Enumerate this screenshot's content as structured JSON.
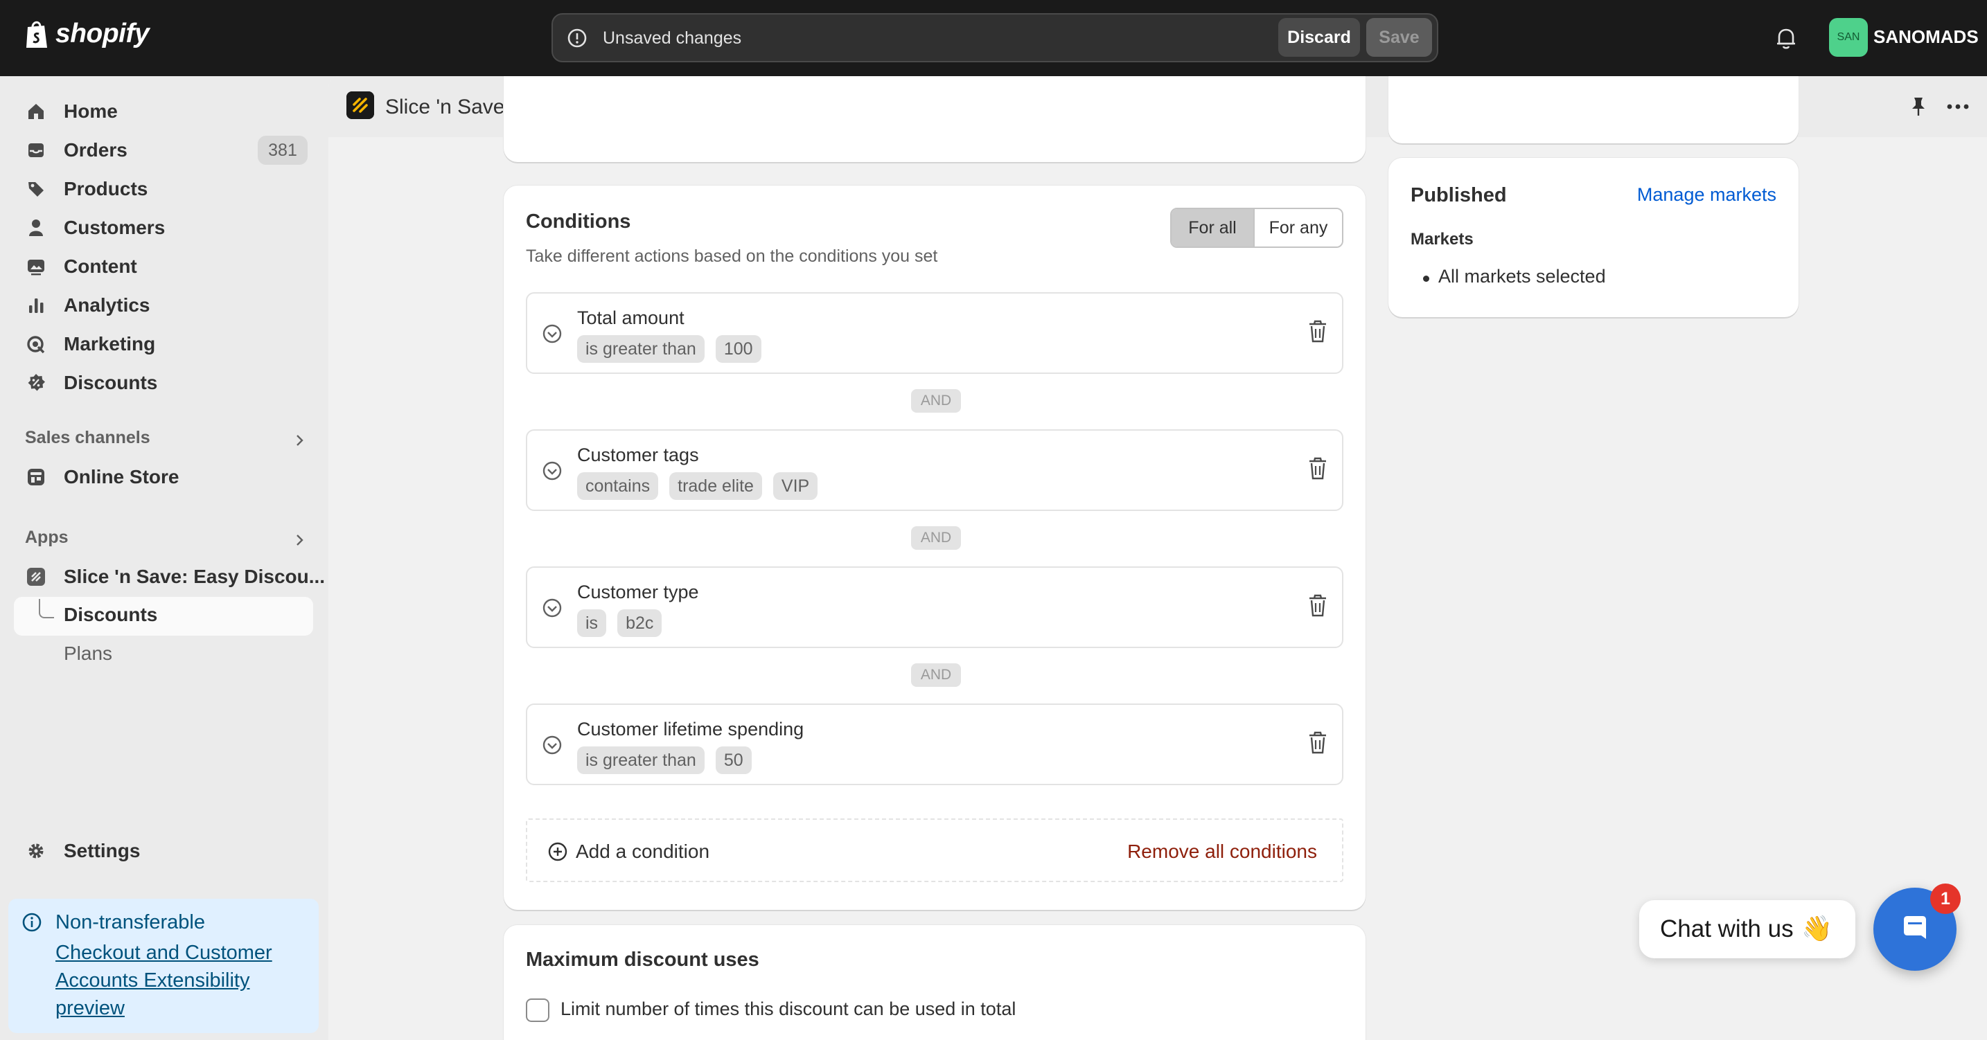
{
  "topbar": {
    "brand": "shopify",
    "unsaved_text": "Unsaved changes",
    "discard_label": "Discard",
    "save_label": "Save",
    "store_initials": "SAN",
    "store_name": "SANOMADS"
  },
  "sidebar": {
    "items": [
      {
        "label": "Home",
        "icon": "home-icon"
      },
      {
        "label": "Orders",
        "icon": "inbox-icon",
        "badge": "381"
      },
      {
        "label": "Products",
        "icon": "tag-icon"
      },
      {
        "label": "Customers",
        "icon": "person-icon"
      },
      {
        "label": "Content",
        "icon": "image-icon"
      },
      {
        "label": "Analytics",
        "icon": "bar-chart-icon"
      },
      {
        "label": "Marketing",
        "icon": "target-icon"
      },
      {
        "label": "Discounts",
        "icon": "discount-icon"
      }
    ],
    "sales_channels_label": "Sales channels",
    "online_store_label": "Online Store",
    "apps_label": "Apps",
    "app_name": "Slice 'n Save: Easy Discou...",
    "sub_discounts": "Discounts",
    "sub_plans": "Plans",
    "settings_label": "Settings",
    "notice_title": "Non-transferable",
    "notice_link": "Checkout and Customer Accounts Extensibility preview"
  },
  "app_header": {
    "title": "Slice 'n Save: Easy Discounts"
  },
  "conditions": {
    "title": "Conditions",
    "subtitle": "Take different actions based on the conditions you set",
    "mode_all": "For all",
    "mode_any": "For any",
    "selected_mode": "For all",
    "connector": "AND",
    "rows": [
      {
        "name": "Total amount",
        "chips": [
          "is greater than",
          "100"
        ]
      },
      {
        "name": "Customer tags",
        "chips": [
          "contains",
          "trade elite",
          "VIP"
        ]
      },
      {
        "name": "Customer type",
        "chips": [
          "is",
          "b2c"
        ]
      },
      {
        "name": "Customer lifetime spending",
        "chips": [
          "is greater than",
          "50"
        ]
      }
    ],
    "add_label": "Add a condition",
    "remove_label": "Remove all conditions"
  },
  "max_uses": {
    "title": "Maximum discount uses",
    "limit_label": "Limit number of times this discount can be used in total",
    "limit_checked": false
  },
  "published": {
    "title": "Published",
    "manage_label": "Manage markets",
    "markets_label": "Markets",
    "markets_value": "All markets selected"
  },
  "chat": {
    "label": "Chat with us",
    "emoji": "👋",
    "badge": "1"
  },
  "colors": {
    "topbar": "#1a1a1a",
    "link": "#005bd3",
    "critical": "#8e1f0b",
    "chat_blue": "#2e73d9",
    "badge_red": "#e5342a"
  }
}
